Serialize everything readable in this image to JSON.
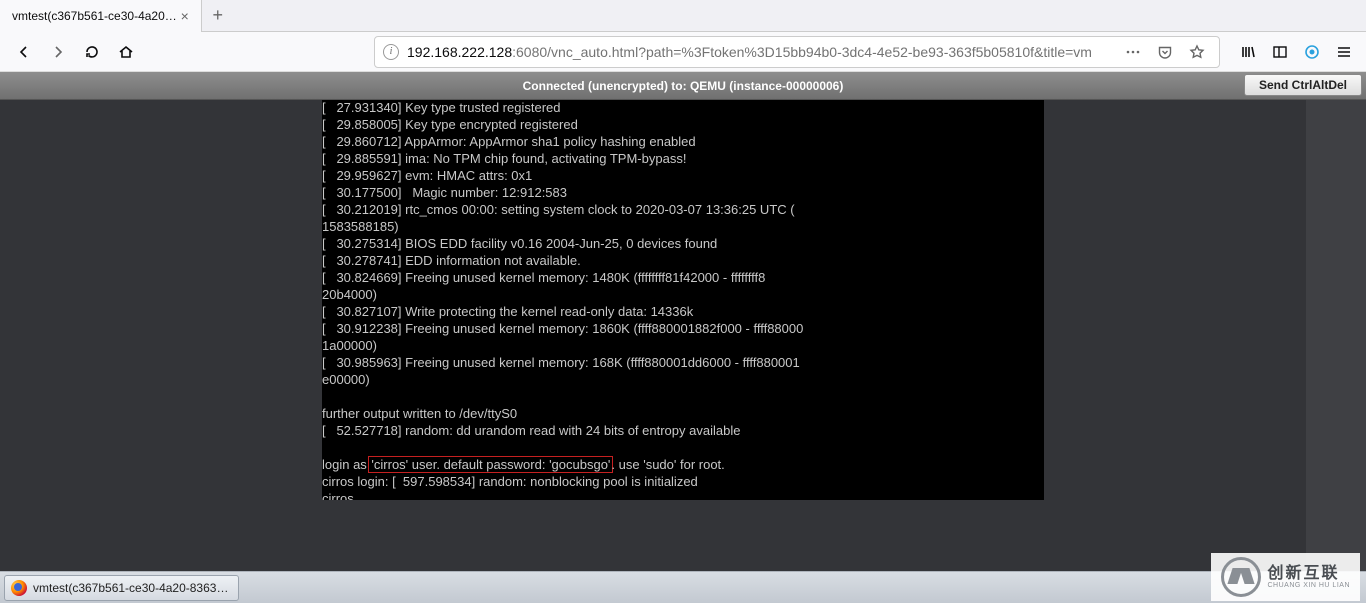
{
  "tab": {
    "title": "vmtest(c367b561-ce30-4a20…"
  },
  "url": {
    "host_ip": "192.168.222.128",
    "rest": ":6080/vnc_auto.html?path=%3Ftoken%3D15bb94b0-3dc4-4e52-be93-363f5b05810f&title=vm"
  },
  "vnc": {
    "status": "Connected (unencrypted) to: QEMU (instance-00000006)",
    "send_cad": "Send CtrlAltDel"
  },
  "console": {
    "pre1": "[   27.931340] Key type trusted registered\n[   29.858005] Key type encrypted registered\n[   29.860712] AppArmor: AppArmor sha1 policy hashing enabled\n[   29.885591] ima: No TPM chip found, activating TPM-bypass!\n[   29.959627] evm: HMAC attrs: 0x1\n[   30.177500]   Magic number: 12:912:583\n[   30.212019] rtc_cmos 00:00: setting system clock to 2020-03-07 13:36:25 UTC (\n1583588185)\n[   30.275314] BIOS EDD facility v0.16 2004-Jun-25, 0 devices found\n[   30.278741] EDD information not available.\n[   30.824669] Freeing unused kernel memory: 1480K (ffffffff81f42000 - ffffffff8\n20b4000)\n[   30.827107] Write protecting the kernel read-only data: 14336k\n[   30.912238] Freeing unused kernel memory: 1860K (ffff880001882f000 - ffff88000\n1a00000)\n[   30.985963] Freeing unused kernel memory: 168K (ffff880001dd6000 - ffff880001\ne00000)\n\nfurther output written to /dev/ttyS0\n[   52.527718] random: dd urandom read with 24 bits of entropy available\n\nlogin as ",
    "highlight": "'cirros' user. default password: 'gocubsgo'",
    "post1": ". use 'sudo' for root.\ncirros login: [  597.598534] random: nonblocking pool is initialized\ncirros"
  },
  "taskbar": {
    "item": "vmtest(c367b561-ce30-4a20-8363…"
  },
  "brand": {
    "cn": "创新互联",
    "en": "CHUANG XIN HU LIAN"
  }
}
